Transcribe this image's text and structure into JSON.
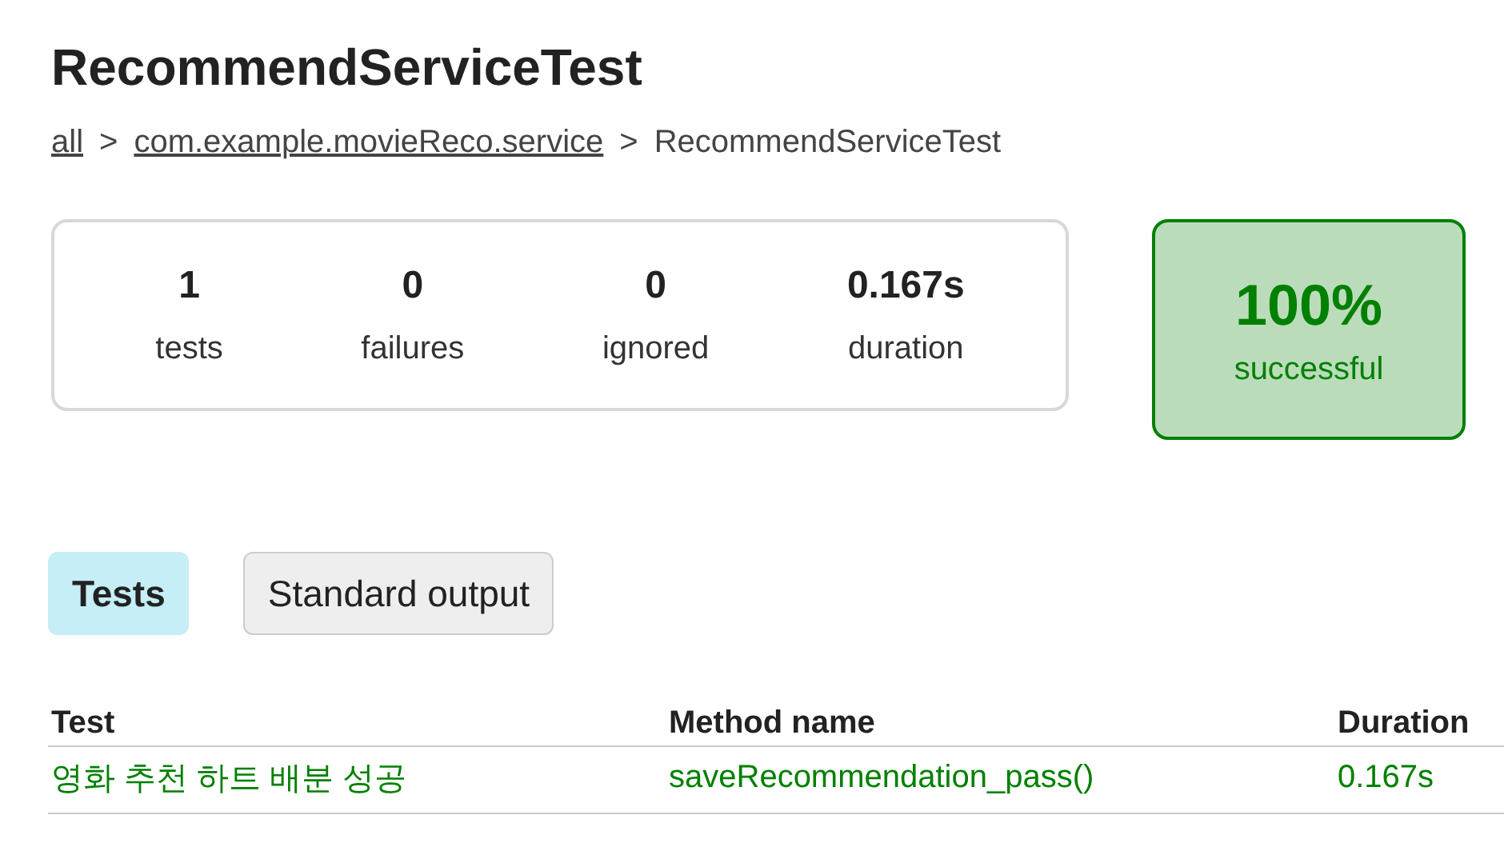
{
  "title": "RecommendServiceTest",
  "breadcrumb": [
    {
      "label": "all",
      "link": true
    },
    {
      "label": "com.example.movieReco.service",
      "link": true
    },
    {
      "label": "RecommendServiceTest",
      "link": false
    }
  ],
  "breadcrumb_separator": ">",
  "summary": {
    "counters": [
      {
        "value": "1",
        "label": "tests"
      },
      {
        "value": "0",
        "label": "failures"
      },
      {
        "value": "0",
        "label": "ignored"
      },
      {
        "value": "0.167s",
        "label": "duration"
      }
    ],
    "success_rate": {
      "value": "100%",
      "label": "successful",
      "passed": true
    }
  },
  "tabs": [
    {
      "label": "Tests",
      "selected": true
    },
    {
      "label": "Standard output",
      "selected": false
    }
  ],
  "table": {
    "columns": [
      "Test",
      "Method name",
      "Duration"
    ],
    "rows": [
      {
        "passed": true,
        "cells": [
          "영화 추천 하트 배분 성공",
          "saveRecommendation_pass()",
          "0.167s"
        ]
      }
    ]
  }
}
